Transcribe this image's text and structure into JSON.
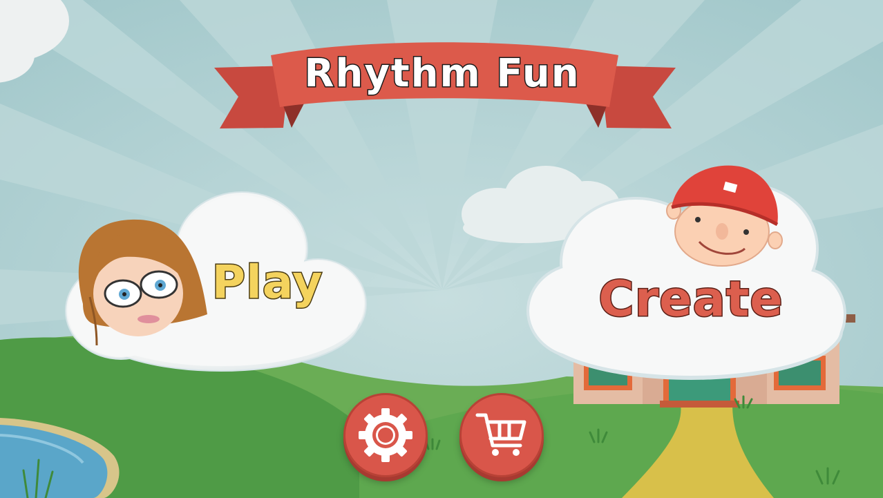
{
  "title": "Rhythm Fun",
  "menu": {
    "play_label": "Play",
    "create_label": "Create"
  },
  "buttons": {
    "settings_icon": "gear-icon",
    "store_icon": "shopping-cart-icon"
  },
  "colors": {
    "sky": "#a9cdd0",
    "grass": "#58a24e",
    "banner": "#d9564a",
    "play_text": "#f4d35e",
    "create_text": "#dc5f4e",
    "round_button": "#d9564a"
  }
}
